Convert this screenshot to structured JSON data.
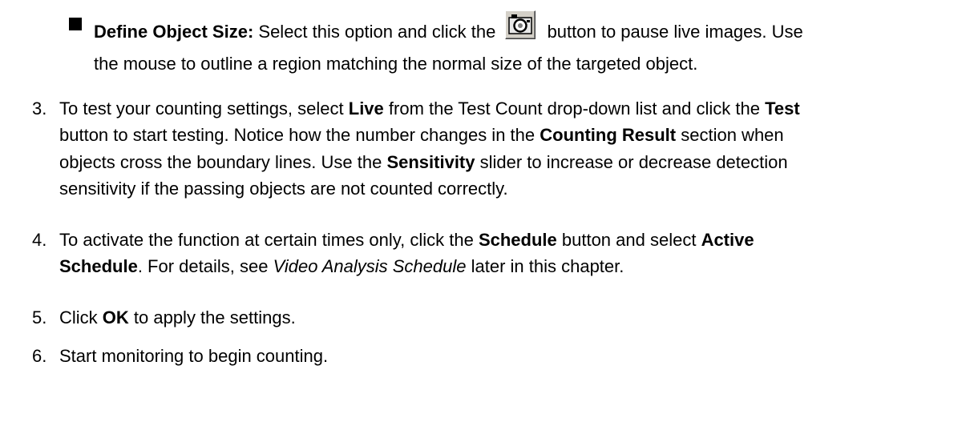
{
  "bullet": {
    "term": "Define Object Size:",
    "line1_before": " Select this option and click the ",
    "button_icon": "camera-icon",
    "line1_after": " button to pause live images. Use",
    "line2": "the mouse to outline a region matching the normal size of the targeted object."
  },
  "steps": [
    {
      "number": "3.",
      "lines": [
        [
          "To test your counting settings, select ",
          "Live",
          " from the Test Count drop-down list and click the ",
          "Test",
          ""
        ],
        [
          "button to start testing. Notice how the number changes in the ",
          "Counting Result",
          " section when",
          "",
          ""
        ],
        [
          "objects cross the boundary lines. Use the ",
          "Sensitivity",
          " slider to increase or decrease detection",
          "",
          ""
        ],
        [
          "sensitivity if the passing objects are not counted correctly.",
          "",
          "",
          "",
          ""
        ]
      ]
    },
    {
      "number": "4.",
      "lines": [
        [
          "To activate the function at certain times only, click the ",
          "Schedule",
          " button and select ",
          "Active",
          ""
        ],
        [
          "Schedule",
          ". For details, see ",
          "Video Analysis Schedule",
          " later in this chapter.",
          ""
        ]
      ]
    },
    {
      "number": "5.",
      "lines": [
        [
          "Click ",
          "OK",
          " to apply the settings.",
          "",
          ""
        ]
      ]
    },
    {
      "number": "6.",
      "lines": [
        [
          "Start monitoring to begin counting.",
          "",
          "",
          "",
          ""
        ]
      ]
    }
  ]
}
